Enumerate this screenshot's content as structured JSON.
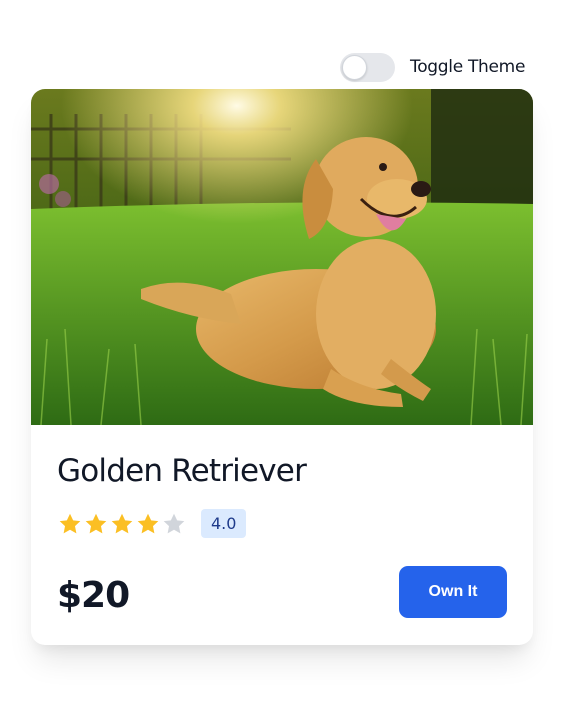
{
  "theme_toggle": {
    "label": "Toggle Theme",
    "state": "off"
  },
  "product": {
    "image_alt": "Golden Retriever",
    "title": "Golden Retriever",
    "rating": {
      "value": 4,
      "max": 5,
      "badge": "4.0"
    },
    "price": "$20",
    "cta_label": "Own It"
  },
  "colors": {
    "accent": "#2563eb",
    "star_filled": "#fbbf24",
    "star_empty": "#d1d5db",
    "badge_bg": "#dbeafe",
    "badge_text": "#1e3a8a"
  }
}
